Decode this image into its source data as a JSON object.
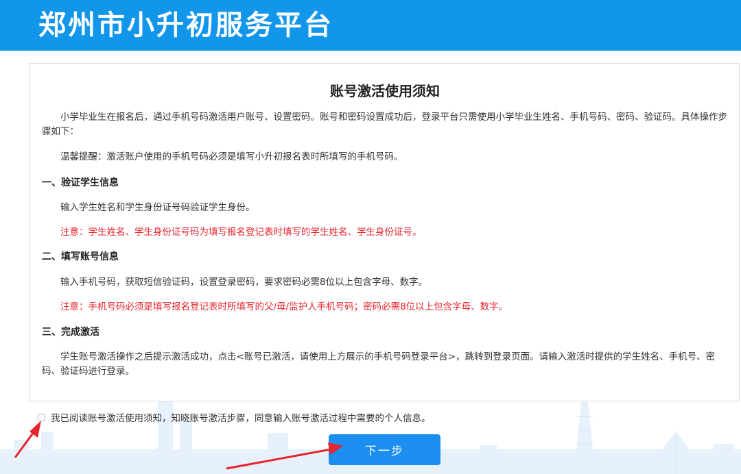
{
  "header": {
    "title": "郑州市小升初服务平台"
  },
  "notice": {
    "title": "账号激活使用须知",
    "intro": "小学毕业生在报名后，通过手机号码激活用户账号、设置密码。账号和密码设置成功后，登录平台只需使用小学毕业生姓名、手机号码、密码、验证码。具体操作步骤如下：",
    "reminder": "温馨提醒：激活账户使用的手机号码必须是填写小升初报名表时所填写的手机号码。",
    "sections": [
      {
        "heading": "一、验证学生信息",
        "text": "输入学生姓名和学生身份证号码验证学生身份。",
        "note": "注意：学生姓名、学生身份证号码为填写报名登记表时填写的学生姓名、学生身份证号。"
      },
      {
        "heading": "二、填写账号信息",
        "text": "输入手机号码，获取短信验证码，设置登录密码，要求密码必需8位以上包含字母、数字。",
        "note": "注意：手机号码必须是填写报名登记表时所填写的父/母/监护人手机号码；密码必需8位以上包含字母、数字。"
      },
      {
        "heading": "三、完成激活",
        "text": "学生账号激活操作之后提示激活成功，点击<账号已激活，请使用上方展示的手机号码登录平台>，跳转到登录页面。请输入激活时提供的学生姓名、手机号、密码、验证码进行登录。"
      }
    ]
  },
  "agreement": {
    "label": "我已阅读账号激活使用须知，知晓账号激活步骤，同意输入账号激活过程中需要的个人信息。",
    "checked": false
  },
  "next_button": {
    "label": "下一步"
  },
  "colors": {
    "brand": "#1296ea",
    "button": "#1b8ef0",
    "warning": "#e8242c",
    "annotation_arrow": "#e8242c"
  }
}
